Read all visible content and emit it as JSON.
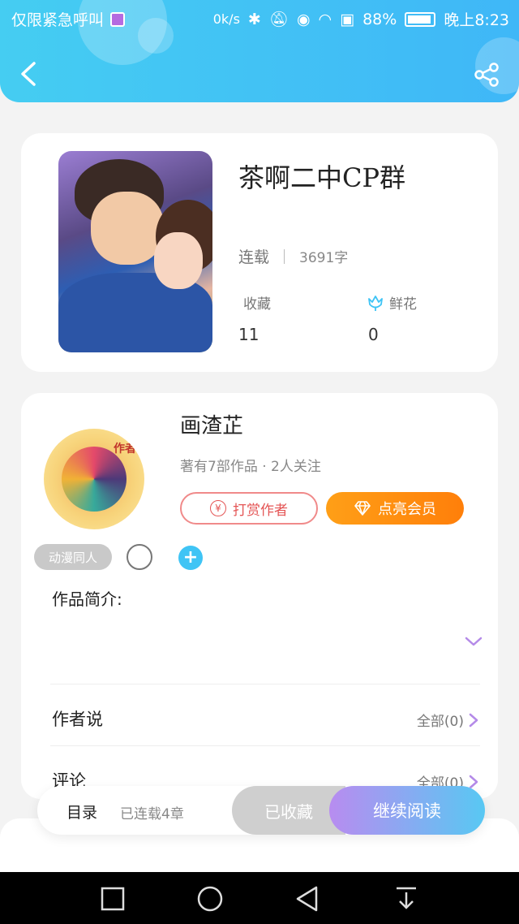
{
  "status_bar": {
    "left_text": "仅限紧急呼叫",
    "net_speed": "0k/s",
    "battery_pct": "88%",
    "time": "晚上8:23"
  },
  "header": {
    "back_icon": "back-arrow-icon",
    "share_icon": "share-icon"
  },
  "book": {
    "title": "茶啊二中CP群",
    "status": "连载",
    "word_count": "3691字",
    "stats": [
      {
        "label": "收藏",
        "value": "11"
      },
      {
        "label": "鲜花",
        "value": "0",
        "icon": "flower-icon"
      }
    ]
  },
  "author": {
    "name": "画渣芷",
    "avatar_tag": "作者",
    "meta": "著有7部作品 · 2人关注",
    "tip_button": "打赏作者",
    "vip_button": "点亮会员",
    "category_chip": "动漫同人"
  },
  "sections": {
    "intro_label": "作品简介:",
    "author_says": {
      "label": "作者说",
      "right": "全部(0)"
    },
    "comments": {
      "label": "评论",
      "right": "全部(0)"
    }
  },
  "action_bar": {
    "toc_label": "目录",
    "toc_count": "已连载4章",
    "favorited_button": "已收藏",
    "read_button": "继续阅读"
  },
  "colors": {
    "header_gradient_start": "#45cdf2",
    "header_gradient_end": "#3fb7f7",
    "vip_orange": "#ff8f12",
    "tip_red": "#e45555",
    "read_gradient_start": "#b88cf0",
    "read_gradient_end": "#58c8f3"
  }
}
